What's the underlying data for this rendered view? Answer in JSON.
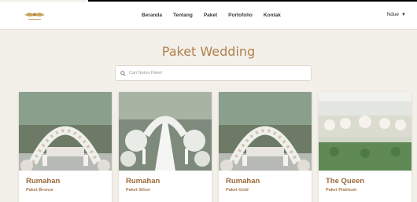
{
  "nav": {
    "links": [
      "Beranda",
      "Tentang",
      "Paket",
      "Portofolio",
      "Kontak"
    ],
    "user": "Ndue",
    "logo_text": "Ndue Wedding"
  },
  "page": {
    "title": "Paket Wedding"
  },
  "search": {
    "placeholder": "Cari Nama Paket"
  },
  "packages": [
    {
      "name": "Rumahan",
      "tier": "Paket Bronze"
    },
    {
      "name": "Rumahan",
      "tier": "Paket Silver"
    },
    {
      "name": "Rumahan",
      "tier": "Paket Gold"
    },
    {
      "name": "The Queen",
      "tier": "Paket Platinum"
    }
  ],
  "colors": {
    "accent": "#b0814f",
    "background": "#f3efe9",
    "title_brown": "#9a6a3b"
  }
}
